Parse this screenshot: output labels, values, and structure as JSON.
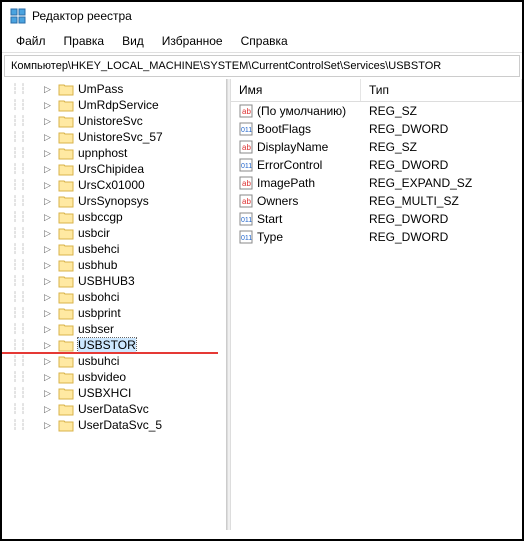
{
  "window": {
    "title": "Редактор реестра"
  },
  "menu": {
    "file": "Файл",
    "edit": "Правка",
    "view": "Вид",
    "favorites": "Избранное",
    "help": "Справка"
  },
  "path": "Компьютер\\HKEY_LOCAL_MACHINE\\SYSTEM\\CurrentControlSet\\Services\\USBSTOR",
  "tree": [
    {
      "label": "UmPass",
      "expandable": true
    },
    {
      "label": "UmRdpService",
      "expandable": true
    },
    {
      "label": "UnistoreSvc",
      "expandable": true
    },
    {
      "label": "UnistoreSvc_57",
      "expandable": true
    },
    {
      "label": "upnphost",
      "expandable": true
    },
    {
      "label": "UrsChipidea",
      "expandable": true
    },
    {
      "label": "UrsCx01000",
      "expandable": true
    },
    {
      "label": "UrsSynopsys",
      "expandable": true
    },
    {
      "label": "usbccgp",
      "expandable": true
    },
    {
      "label": "usbcir",
      "expandable": true
    },
    {
      "label": "usbehci",
      "expandable": true
    },
    {
      "label": "usbhub",
      "expandable": true
    },
    {
      "label": "USBHUB3",
      "expandable": true
    },
    {
      "label": "usbohci",
      "expandable": true
    },
    {
      "label": "usbprint",
      "expandable": true
    },
    {
      "label": "usbser",
      "expandable": true
    },
    {
      "label": "USBSTOR",
      "expandable": true,
      "selected": true,
      "underline": true
    },
    {
      "label": "usbuhci",
      "expandable": true
    },
    {
      "label": "usbvideo",
      "expandable": true
    },
    {
      "label": "USBXHCI",
      "expandable": true
    },
    {
      "label": "UserDataSvc",
      "expandable": true
    },
    {
      "label": "UserDataSvc_5",
      "expandable": true
    }
  ],
  "list": {
    "header_name": "Имя",
    "header_type": "Тип",
    "rows": [
      {
        "icon": "string",
        "name": "(По умолчанию)",
        "type": "REG_SZ"
      },
      {
        "icon": "binary",
        "name": "BootFlags",
        "type": "REG_DWORD"
      },
      {
        "icon": "string",
        "name": "DisplayName",
        "type": "REG_SZ"
      },
      {
        "icon": "binary",
        "name": "ErrorControl",
        "type": "REG_DWORD"
      },
      {
        "icon": "string",
        "name": "ImagePath",
        "type": "REG_EXPAND_SZ"
      },
      {
        "icon": "string",
        "name": "Owners",
        "type": "REG_MULTI_SZ"
      },
      {
        "icon": "binary",
        "name": "Start",
        "type": "REG_DWORD"
      },
      {
        "icon": "binary",
        "name": "Type",
        "type": "REG_DWORD"
      }
    ]
  }
}
